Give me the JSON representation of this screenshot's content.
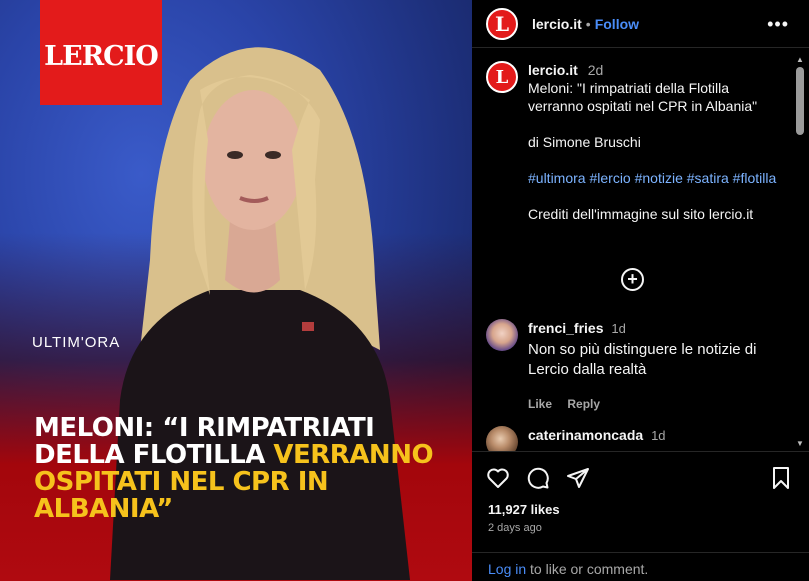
{
  "post": {
    "logo_text": "LERCIO",
    "banner": "ULTIM'ORA",
    "headline_white": "MELONI: “I RIMPATRIATI DELLA FLOTILLA",
    "headline_yellow": "VERRANNO OSPITATI NEL CPR IN ALBANIA”"
  },
  "header": {
    "avatar_letter": "L",
    "username": "lercio.it",
    "separator": "•",
    "follow_label": "Follow",
    "more_icon": "more-horizontal-icon"
  },
  "caption": {
    "avatar_letter": "L",
    "username": "lercio.it",
    "time": "2d",
    "title": "Meloni: \"I rimpatriati della Flotilla verranno ospitati nel CPR in Albania\"",
    "author": "di Simone Bruschi",
    "hashtags": "#ultimora #lercio #notizie #satira #flotilla",
    "credits": "Crediti dell'immagine sul sito lercio.it",
    "plus_symbol": "+"
  },
  "comments": [
    {
      "username": "frenci_fries",
      "time": "1d",
      "text": "Non so più distinguere le notizie di Lercio dalla realtà",
      "like_label": "Like",
      "reply_label": "Reply"
    },
    {
      "username": "caterinamoncada",
      "time": "1d"
    }
  ],
  "footer": {
    "likes": "11,927 likes",
    "time_ago": "2 days ago",
    "login_link": "Log in",
    "login_rest": " to like or comment."
  },
  "colors": {
    "brand_red": "#e31b1b",
    "link_blue": "#4a8df8",
    "hashtag_blue": "#7cb3ff",
    "headline_yellow": "#f6c21c"
  }
}
